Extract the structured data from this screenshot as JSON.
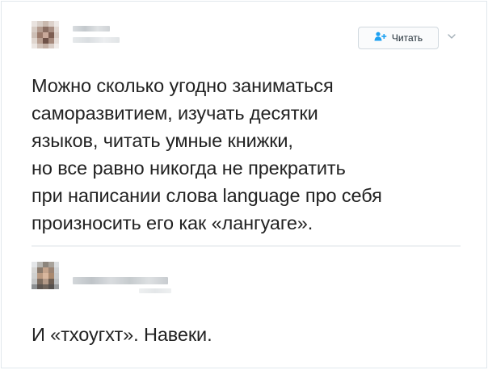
{
  "tweet": {
    "author_name": "",
    "author_handle": "",
    "follow_button": {
      "label": "Читать",
      "icon": "follow-person-plus-icon"
    },
    "more_menu_icon": "chevron-down-icon",
    "text": "Можно сколько угодно заниматься\nсаморазвитием, изучать десятки\nязыков, читать умные книжки,\nно все равно никогда не прекратить\nпри написании слова language про себя\nпроизносить его как «лангуаге»."
  },
  "reply": {
    "author_name": "",
    "text": "И «тхоугхт». Навеки."
  },
  "colors": {
    "accent": "#1da1f2",
    "text": "#222222",
    "divider": "#d7dde2",
    "button_border": "#d0d8de"
  }
}
